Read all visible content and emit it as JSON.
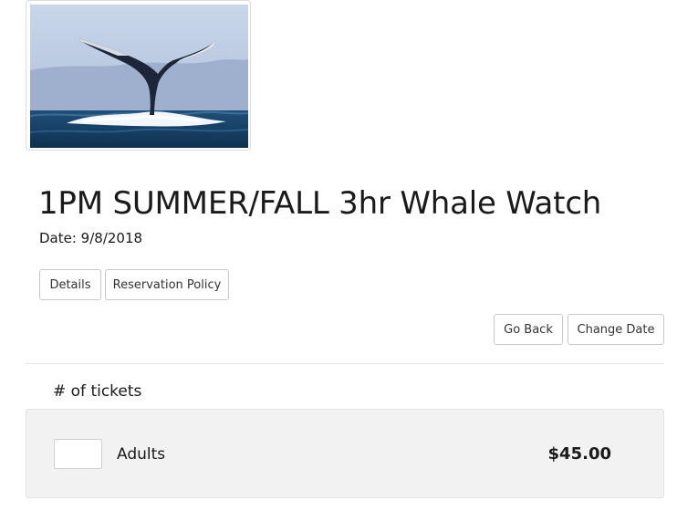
{
  "tour": {
    "title": "1PM SUMMER/FALL 3hr Whale Watch",
    "date_label": "Date: 9/8/2018"
  },
  "info_tabs": {
    "details_label": "Details",
    "policy_label": "Reservation Policy"
  },
  "nav": {
    "go_back_label": "Go Back",
    "change_date_label": "Change Date"
  },
  "tickets": {
    "heading": "# of tickets",
    "rows": [
      {
        "label": "Adults",
        "price": "$45.00",
        "quantity": ""
      }
    ]
  },
  "colors": {
    "panel_background": "#f2f2f2",
    "button_border": "#c8c8c8",
    "text": "#1a1a1a"
  }
}
